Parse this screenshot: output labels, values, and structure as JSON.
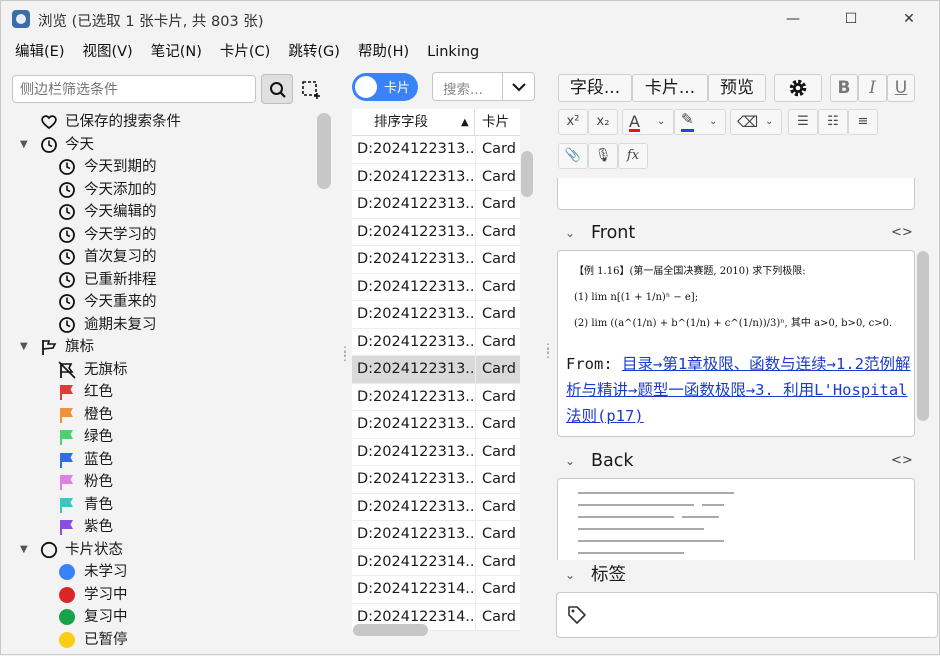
{
  "window": {
    "title": "浏览 (已选取 1 张卡片, 共 803 张)",
    "minimize": "—",
    "maximize": "☐",
    "close": "✕"
  },
  "menubar": [
    "编辑(E)",
    "视图(V)",
    "笔记(N)",
    "卡片(C)",
    "跳转(G)",
    "帮助(H)",
    "Linking"
  ],
  "sidebar": {
    "search_placeholder": "侧边栏筛选条件",
    "tree": [
      {
        "label": "已保存的搜索条件",
        "level": 0,
        "icon": "heart-icon",
        "caret": ""
      },
      {
        "label": "今天",
        "level": 0,
        "icon": "clock-icon",
        "caret": "▼"
      },
      {
        "label": "今天到期的",
        "level": 1,
        "icon": "clock-icon"
      },
      {
        "label": "今天添加的",
        "level": 1,
        "icon": "clock-icon"
      },
      {
        "label": "今天编辑的",
        "level": 1,
        "icon": "clock-icon"
      },
      {
        "label": "今天学习的",
        "level": 1,
        "icon": "clock-icon"
      },
      {
        "label": "首次复习的",
        "level": 1,
        "icon": "clock-icon"
      },
      {
        "label": "已重新排程",
        "level": 1,
        "icon": "clock-icon"
      },
      {
        "label": "今天重来的",
        "level": 1,
        "icon": "clock-icon"
      },
      {
        "label": "逾期未复习",
        "level": 1,
        "icon": "clock-icon"
      },
      {
        "label": "旗标",
        "level": 0,
        "icon": "flag-outline-icon",
        "caret": "▼"
      },
      {
        "label": "无旗标",
        "level": 1,
        "icon": "flag-off-icon"
      },
      {
        "label": "红色",
        "level": 1,
        "icon": "flag-icon",
        "color": "#e03a3a"
      },
      {
        "label": "橙色",
        "level": 1,
        "icon": "flag-icon",
        "color": "#f0923a"
      },
      {
        "label": "绿色",
        "level": 1,
        "icon": "flag-icon",
        "color": "#4fd070"
      },
      {
        "label": "蓝色",
        "level": 1,
        "icon": "flag-icon",
        "color": "#2f6fe0"
      },
      {
        "label": "粉色",
        "level": 1,
        "icon": "flag-icon",
        "color": "#e080e0"
      },
      {
        "label": "青色",
        "level": 1,
        "icon": "flag-icon",
        "color": "#35c9c0"
      },
      {
        "label": "紫色",
        "level": 1,
        "icon": "flag-icon",
        "color": "#8a4fe0"
      },
      {
        "label": "卡片状态",
        "level": 0,
        "icon": "circle-outline-icon",
        "caret": "▼"
      },
      {
        "label": "未学习",
        "level": 1,
        "icon": "dot-icon",
        "color": "#3b82f6"
      },
      {
        "label": "学习中",
        "level": 1,
        "icon": "dot-icon",
        "color": "#dc2626"
      },
      {
        "label": "复习中",
        "level": 1,
        "icon": "dot-icon",
        "color": "#16a34a"
      },
      {
        "label": "已暂停",
        "level": 1,
        "icon": "dot-icon",
        "color": "#facc15"
      }
    ]
  },
  "cardlist": {
    "toggle_label": "卡片",
    "search_placeholder": "搜索...",
    "col_sort": "排序字段",
    "col_card": "卡片",
    "rows": [
      {
        "sort": "D:2024122313...",
        "card": "Card"
      },
      {
        "sort": "D:2024122313...",
        "card": "Card"
      },
      {
        "sort": "D:2024122313...",
        "card": "Card"
      },
      {
        "sort": "D:2024122313...",
        "card": "Card"
      },
      {
        "sort": "D:2024122313...",
        "card": "Card"
      },
      {
        "sort": "D:2024122313...",
        "card": "Card"
      },
      {
        "sort": "D:2024122313...",
        "card": "Card"
      },
      {
        "sort": "D:2024122313...",
        "card": "Card"
      },
      {
        "sort": "D:2024122313...",
        "card": "Card",
        "selected": true
      },
      {
        "sort": "D:2024122313...",
        "card": "Card"
      },
      {
        "sort": "D:2024122313...",
        "card": "Card"
      },
      {
        "sort": "D:2024122313...",
        "card": "Card"
      },
      {
        "sort": "D:2024122313...",
        "card": "Card"
      },
      {
        "sort": "D:2024122313...",
        "card": "Card"
      },
      {
        "sort": "D:2024122313...",
        "card": "Card"
      },
      {
        "sort": "D:2024122314...",
        "card": "Card"
      },
      {
        "sort": "D:2024122314...",
        "card": "Card"
      },
      {
        "sort": "D:2024122314...",
        "card": "Card"
      }
    ]
  },
  "editor": {
    "fields_btn": "字段...",
    "cards_btn": "卡片...",
    "preview_btn": "预览",
    "bold": "B",
    "italic": "I",
    "underline": "U",
    "superscript": "x²",
    "subscript": "x₂",
    "front_label": "Front",
    "back_label": "Back",
    "tags_label": "标签",
    "code_toggle": "<>",
    "problem_line1": "【例 1.16】(第一届全国决赛题, 2010)  求下列极限:",
    "problem_line2": "(1) lim n[(1 + 1/n)ⁿ − e];",
    "problem_line3": "(2) lim ((a^(1/n) + b^(1/n) + c^(1/n))/3)ⁿ, 其中 a>0, b>0, c>0.",
    "from_prefix": "From: ",
    "from_link": "目录→第1章极限、函数与连续→1.2范例解析与精讲→题型一函数极限→3. 利用L'Hospital 法则(p17)"
  }
}
